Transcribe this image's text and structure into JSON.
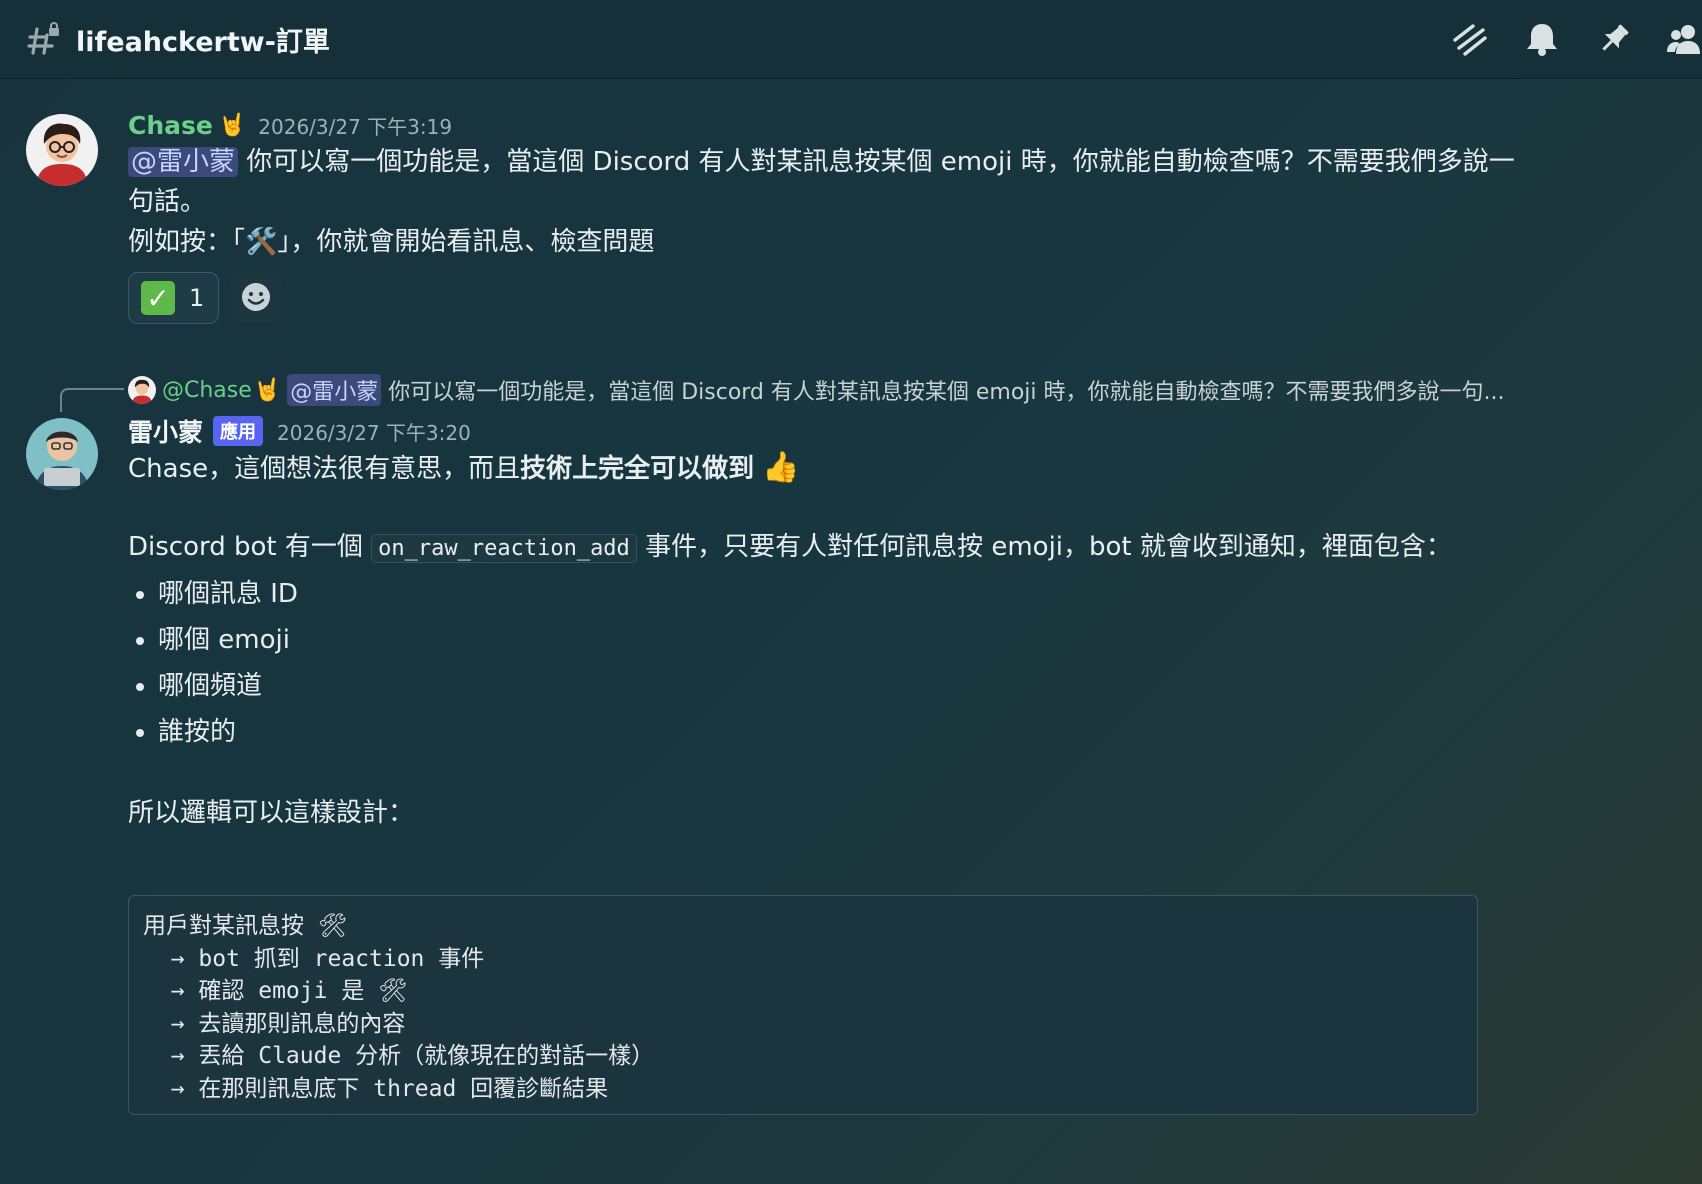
{
  "channel": {
    "name": "lifeahckertw-訂單"
  },
  "top_icons": [
    "threads-icon",
    "bell-icon",
    "pin-icon",
    "members-icon"
  ],
  "messages": [
    {
      "author": "Chase",
      "author_emoji": "🤘",
      "author_color": "#6ccf8a",
      "timestamp": "2026/3/27 下午3:19",
      "mention": "@雷小蒙",
      "line1": " 你可以寫一個功能是，當這個 Discord 有人對某訊息按某個 emoji 時，你就能自動檢查嗎？不需要我們多說一",
      "line2": "句話。",
      "line3": "例如按：「🛠️」，你就會開始看訊息、檢查問題",
      "reaction": {
        "emoji": "✓",
        "count": "1"
      }
    },
    {
      "reply_preview": {
        "author": "@Chase",
        "author_emoji": "🤘",
        "mention": "@雷小蒙",
        "text": " 你可以寫一個功能是，當這個 Discord 有人對某訊息按某個 emoji 時，你就能自動檢查嗎？不需要我們多說一句..."
      },
      "author": "雷小蒙",
      "badge": "應用",
      "timestamp": "2026/3/27 下午3:20",
      "intro_prefix": "Chase，這個想法很有意思，而且",
      "intro_bold": "技術上完全可以做到",
      "intro_emoji": "👍",
      "event_prefix": "Discord bot 有一個 ",
      "event_code": "on_raw_reaction_add",
      "event_suffix": " 事件，只要有人對任何訊息按 emoji，bot 就會收到通知，裡面包含：",
      "bullets": [
        "哪個訊息 ID",
        "哪個 emoji",
        "哪個頻道",
        "誰按的"
      ],
      "logic_intro": "所以邏輯可以這樣設計：",
      "code_lines": [
        "用戶對某訊息按 🛠",
        "  → bot 抓到 reaction 事件",
        "  → 確認 emoji 是 🛠",
        "  → 去讀那則訊息的內容",
        "  → 丟給 Claude 分析（就像現在的對話一樣）",
        "  → 在那則訊息底下 thread 回覆診斷結果"
      ]
    }
  ]
}
